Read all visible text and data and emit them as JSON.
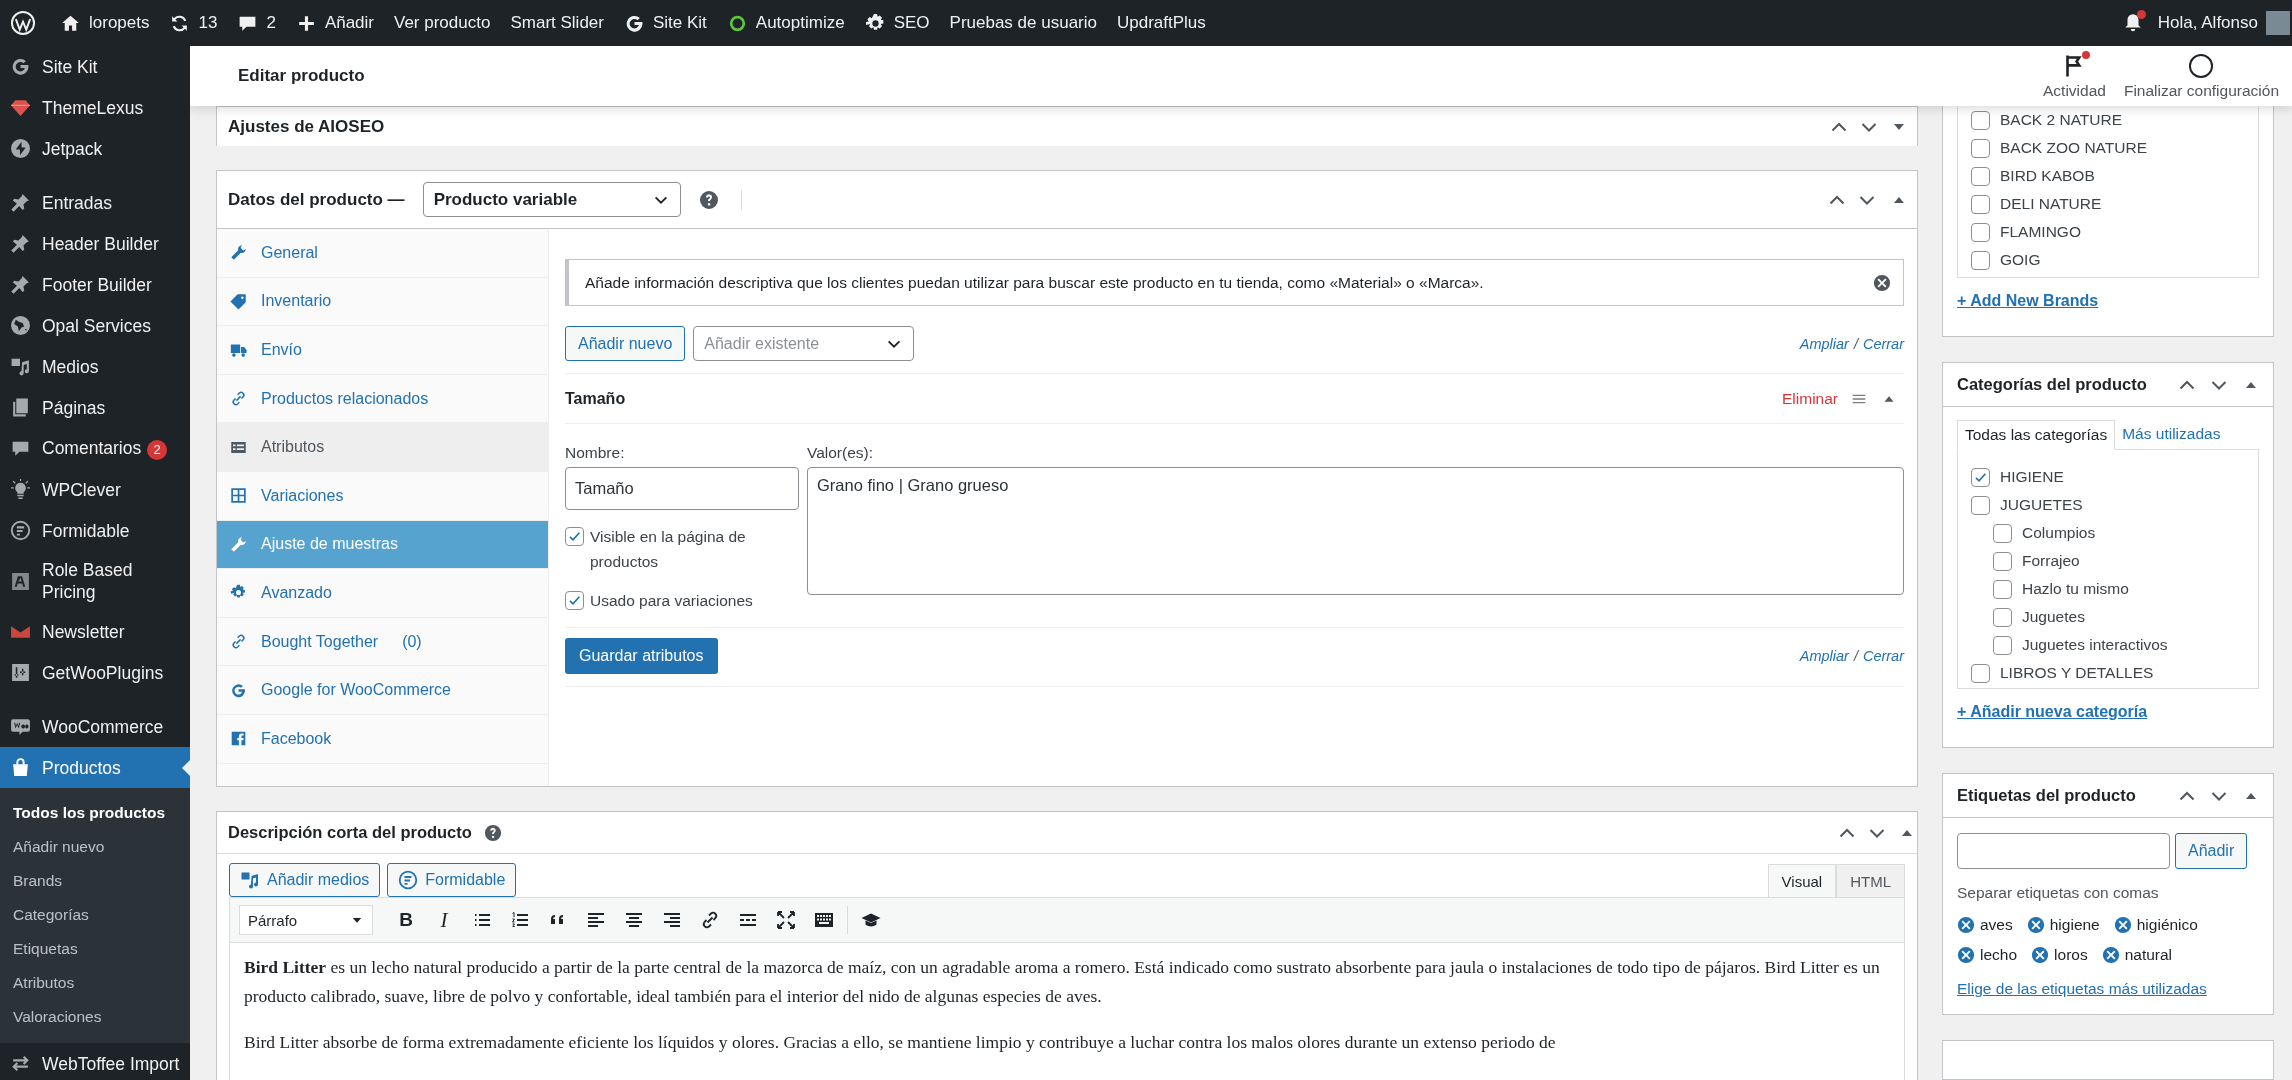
{
  "admin_bar": {
    "items": [
      {
        "kind": "wordpress"
      },
      {
        "kind": "site",
        "label": "loropets"
      },
      {
        "kind": "updates",
        "label": "13"
      },
      {
        "kind": "comments",
        "label": "2"
      },
      {
        "kind": "new",
        "label": "Añadir"
      },
      {
        "kind": "text",
        "label": "Ver producto"
      },
      {
        "kind": "text",
        "label": "Smart Slider"
      },
      {
        "kind": "sitekit",
        "label": "Site Kit"
      },
      {
        "kind": "autoptimize",
        "label": "Autoptimize"
      },
      {
        "kind": "seo",
        "label": "SEO"
      },
      {
        "kind": "text",
        "label": "Pruebas de usuario"
      },
      {
        "kind": "text",
        "label": "UpdraftPlus"
      }
    ],
    "notifications": true,
    "greeting": "Hola, Alfonso"
  },
  "sidebar": {
    "groups": [
      {
        "items": [
          {
            "kind": "sitekit",
            "label": "Site Kit",
            "selected": false
          },
          {
            "kind": "themelexus",
            "label": "ThemeLexus",
            "selected": false
          },
          {
            "kind": "jetpack",
            "label": "Jetpack",
            "selected": false
          }
        ]
      },
      {
        "items": [
          {
            "kind": "pin",
            "label": "Entradas",
            "selected": false
          },
          {
            "kind": "pin",
            "label": "Header Builder",
            "selected": false
          },
          {
            "kind": "pin",
            "label": "Footer Builder",
            "selected": false
          },
          {
            "kind": "globe",
            "label": "Opal Services",
            "selected": false
          },
          {
            "kind": "media",
            "label": "Medios",
            "selected": false
          },
          {
            "kind": "pages",
            "label": "Páginas",
            "selected": false
          },
          {
            "kind": "comments",
            "label": "Comentarios",
            "badge": "2",
            "selected": false
          },
          {
            "kind": "bulb",
            "label": "WPClever",
            "selected": false
          },
          {
            "kind": "formidable",
            "label": "Formidable",
            "selected": false
          },
          {
            "kind": "role",
            "label": "Role Based Pricing",
            "selected": false
          },
          {
            "kind": "newsletter",
            "label": "Newsletter",
            "selected": false
          },
          {
            "kind": "getwoo",
            "label": "GetWooPlugins",
            "selected": false
          }
        ]
      },
      {
        "items": [
          {
            "kind": "woo",
            "label": "WooCommerce",
            "selected": false
          },
          {
            "kind": "products",
            "label": "Productos",
            "selected": true,
            "submenu": [
              {
                "label": "Todos los productos",
                "selected": true
              },
              {
                "label": "Añadir nuevo",
                "selected": false
              },
              {
                "label": "Brands",
                "selected": false
              },
              {
                "label": "Categorías",
                "selected": false
              },
              {
                "label": "Etiquetas",
                "selected": false
              },
              {
                "label": "Atributos",
                "selected": false
              },
              {
                "label": "Valoraciones",
                "selected": false
              }
            ]
          },
          {
            "kind": "transfer",
            "label": "WebToffee Import",
            "selected": false
          }
        ]
      }
    ]
  },
  "header": {
    "title": "Editar producto",
    "actions": [
      {
        "kind": "activity",
        "label": "Actividad",
        "unread": true
      },
      {
        "kind": "setup",
        "label": "Finalizar configuración",
        "unread": false
      }
    ]
  },
  "aioseo": {
    "title": "Ajustes de AIOSEO",
    "expanded": false
  },
  "product_data": {
    "title": "Datos del producto —",
    "product_type": "Producto variable",
    "expanded": true,
    "tabs": [
      {
        "kind": "general",
        "label": "General",
        "selected": false,
        "hovered": false
      },
      {
        "kind": "inventory",
        "label": "Inventario",
        "selected": false,
        "hovered": false
      },
      {
        "kind": "shipping",
        "label": "Envío",
        "selected": false,
        "hovered": false
      },
      {
        "kind": "linked",
        "label": "Productos relacionados",
        "selected": false,
        "hovered": false
      },
      {
        "kind": "attributes",
        "label": "Atributos",
        "selected": true,
        "hovered": false
      },
      {
        "kind": "variations",
        "label": "Variaciones",
        "selected": false,
        "hovered": false
      },
      {
        "kind": "swatches",
        "label": "Ajuste de muestras",
        "selected": false,
        "hovered": true
      },
      {
        "kind": "advanced",
        "label": "Avanzado",
        "selected": false,
        "hovered": false
      },
      {
        "kind": "bought_together",
        "label": "Bought Together",
        "count": "(0)",
        "selected": false,
        "hovered": false
      },
      {
        "kind": "google",
        "label": "Google for WooCommerce",
        "selected": false,
        "hovered": false
      },
      {
        "kind": "facebook",
        "label": "Facebook",
        "selected": false,
        "hovered": false
      }
    ],
    "notice": "Añade información descriptiva que los clientes puedan utilizar para buscar este producto en tu tienda, como «Material» o «Marca».",
    "add_new_button": "Añadir nuevo",
    "add_existing_placeholder": "Añadir existente",
    "top_links": {
      "expand": "Ampliar",
      "separator": "/",
      "collapse": "Cerrar"
    },
    "attribute": {
      "title": "Tamaño",
      "remove": "Eliminar",
      "expanded": true,
      "name_label": "Nombre:",
      "name_value": "Tamaño",
      "values_label": "Valor(es):",
      "values": "Grano fino | Grano grueso",
      "options": [
        {
          "label": "Visible en la página de productos",
          "checked": true
        },
        {
          "label": "Usado para variaciones",
          "checked": true
        }
      ]
    },
    "save_button": "Guardar atributos",
    "bottom_links": {
      "expand": "Ampliar",
      "separator": "/",
      "collapse": "Cerrar"
    }
  },
  "short_description": {
    "title": "Descripción corta del producto",
    "expanded": true,
    "media_buttons": [
      {
        "kind": "media",
        "label": "Añadir medios"
      },
      {
        "kind": "formidable",
        "label": "Formidable"
      }
    ],
    "editor_tabs": [
      {
        "label": "Visual",
        "selected": true
      },
      {
        "label": "HTML",
        "selected": false
      }
    ],
    "format": "Párrafo",
    "toolbar": [
      {
        "kind": "bold",
        "glyph": "B"
      },
      {
        "kind": "italic",
        "glyph": "I"
      },
      {
        "kind": "bullets"
      },
      {
        "kind": "numbers"
      },
      {
        "kind": "quote"
      },
      {
        "kind": "align_left"
      },
      {
        "kind": "align_center"
      },
      {
        "kind": "align_right"
      },
      {
        "kind": "link"
      },
      {
        "kind": "more"
      },
      {
        "kind": "fullscreen"
      },
      {
        "kind": "keyboard"
      },
      {
        "kind": "cap"
      }
    ],
    "paragraphs": [
      "**Bird Litter** es un lecho natural producido a partir de la parte central de la mazorca de maíz, con un agradable aroma a romero. Está indicado como sustrato absorbente para jaula o instalaciones de todo tipo de pájaros. Bird Litter es un producto calibrado, suave, libre de polvo y confortable, ideal también para el interior del nido de algunas especies de aves.",
      "Bird Litter absorbe de forma extremadamente eficiente los líquidos y olores. Gracias a ello, se mantiene limpio y contribuye a luchar contra los malos olores durante un extenso periodo de"
    ]
  },
  "brands": {
    "items": [
      {
        "label": "BACK 2 NATURE",
        "checked": false
      },
      {
        "label": "BACK ZOO NATURE",
        "checked": false
      },
      {
        "label": "BIRD KABOB",
        "checked": false
      },
      {
        "label": "DELI NATURE",
        "checked": false
      },
      {
        "label": "FLAMINGO",
        "checked": false
      },
      {
        "label": "GOIG",
        "checked": false
      }
    ],
    "add_link": "+ Add New Brands"
  },
  "categories": {
    "title": "Categorías del producto",
    "expanded": true,
    "tabs": [
      {
        "label": "Todas las categorías",
        "selected": true
      },
      {
        "label": "Más utilizadas",
        "selected": false
      }
    ],
    "items": [
      {
        "label": "HIGIENE",
        "checked": true
      },
      {
        "label": "JUGUETES",
        "checked": false,
        "children": [
          {
            "label": "Columpios",
            "checked": false
          },
          {
            "label": "Forrajeo",
            "checked": false
          },
          {
            "label": "Hazlo tu mismo",
            "checked": false
          },
          {
            "label": "Juguetes",
            "checked": false
          },
          {
            "label": "Juguetes interactivos",
            "checked": false
          }
        ]
      },
      {
        "label": "LIBROS Y DETALLES",
        "checked": false
      }
    ],
    "add_link": "+ Añadir nueva categoría"
  },
  "tags": {
    "title": "Etiquetas del producto",
    "expanded": true,
    "add_button": "Añadir",
    "hint": "Separar etiquetas con comas",
    "tags": [
      "aves",
      "higiene",
      "higiénico",
      "lecho",
      "loros",
      "natural"
    ],
    "choose_link": "Elige de las etiquetas más utilizadas"
  }
}
